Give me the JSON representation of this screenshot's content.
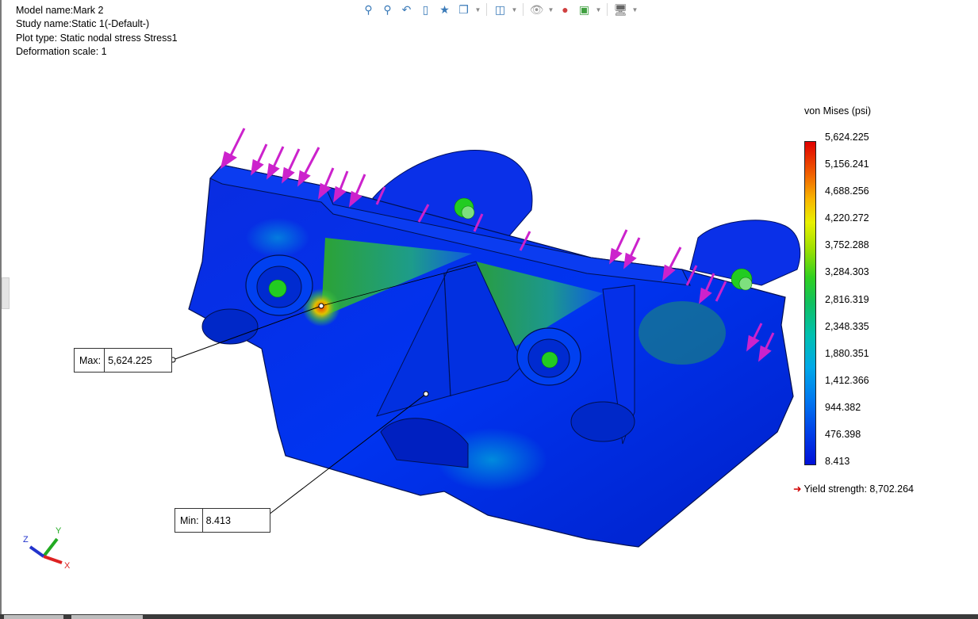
{
  "info": {
    "model_name": "Model name:Mark 2",
    "study_name": "Study name:Static 1(-Default-)",
    "plot_type": "Plot type: Static nodal stress Stress1",
    "deformation_scale": "Deformation scale: 1"
  },
  "toolbar": {
    "icons": [
      "zoom-to-fit-icon",
      "zoom-to-area-icon",
      "previous-view-icon",
      "section-view-icon",
      "view-setting-icon",
      "view-orientation-icon",
      "display-style-icon",
      "hide-show-icon",
      "edit-appearance-icon",
      "apply-scene-icon",
      "display-settings-icon"
    ]
  },
  "callouts": {
    "max_label": "Max:",
    "max_value": "5,624.225",
    "min_label": "Min:",
    "min_value": "8.413"
  },
  "legend": {
    "title": "von Mises (psi)",
    "ticks": [
      "5,624.225",
      "5,156.241",
      "4,688.256",
      "4,220.272",
      "3,752.288",
      "3,284.303",
      "2,816.319",
      "2,348.335",
      "1,880.351",
      "1,412.366",
      "944.382",
      "476.398",
      "8.413"
    ],
    "yield_label": "Yield strength: 8,702.264"
  },
  "triad": {
    "x": "X",
    "y": "Y",
    "z": "Z"
  },
  "colors": {
    "max_stress": "#e00000",
    "min_stress": "#0010d8",
    "load_arrow": "#cc22cc",
    "fixture": "#22cc22"
  }
}
